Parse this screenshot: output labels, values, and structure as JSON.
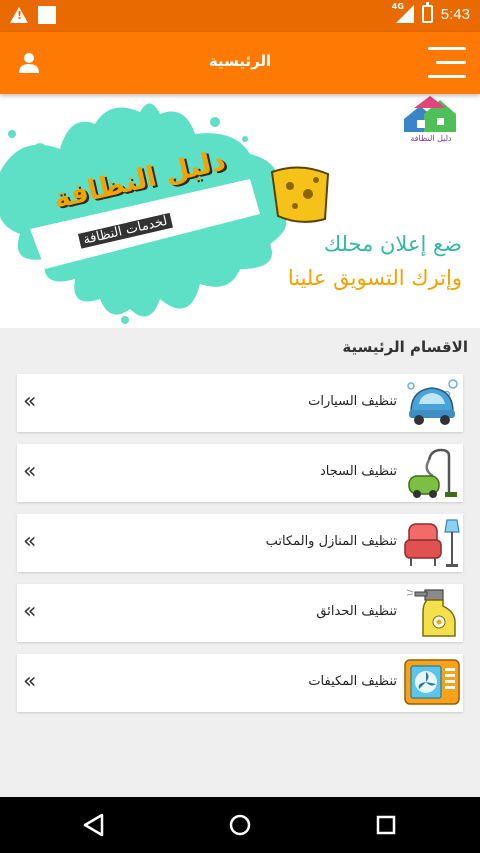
{
  "status_bar": {
    "time": "5:43",
    "network": "4G",
    "icons": [
      "warning-icon",
      "notification-square-icon",
      "signal-icon",
      "battery-charging-icon"
    ]
  },
  "app_bar": {
    "title": "الرئيسية",
    "left_icon": "user-icon",
    "right_icon": "menu-icon"
  },
  "banner": {
    "logo_caption": "دليل النظافة",
    "splash_title": "دليل النظافة",
    "splash_subtitle": "لخدمات النظافة",
    "ad_line1": "ضع إعلان محلك",
    "ad_line2": "وإترك التسويق علينا"
  },
  "section": {
    "title": "الاقسام الرئيسية",
    "items": [
      {
        "label": "تنظيف السيارات",
        "icon": "car-wash-icon",
        "arrow": "«"
      },
      {
        "label": "تنظيف السجاد",
        "icon": "vacuum-cleaner-icon",
        "arrow": "«"
      },
      {
        "label": "تنظيف المنازل والمكاتب",
        "icon": "armchair-lamp-icon",
        "arrow": "«"
      },
      {
        "label": "تنظيف الحدائق",
        "icon": "spray-bottle-icon",
        "arrow": "«"
      },
      {
        "label": "تنظيف المكيفات",
        "icon": "air-conditioner-icon",
        "arrow": "«"
      }
    ]
  },
  "colors": {
    "status_bar": "#e86a00",
    "app_bar": "#ff7a05",
    "ad_teal": "#37b8a6",
    "ad_orange": "#f5a100",
    "background": "#efefef"
  },
  "nav_bar": {
    "icons": [
      "back-icon",
      "home-icon",
      "recents-icon"
    ]
  }
}
